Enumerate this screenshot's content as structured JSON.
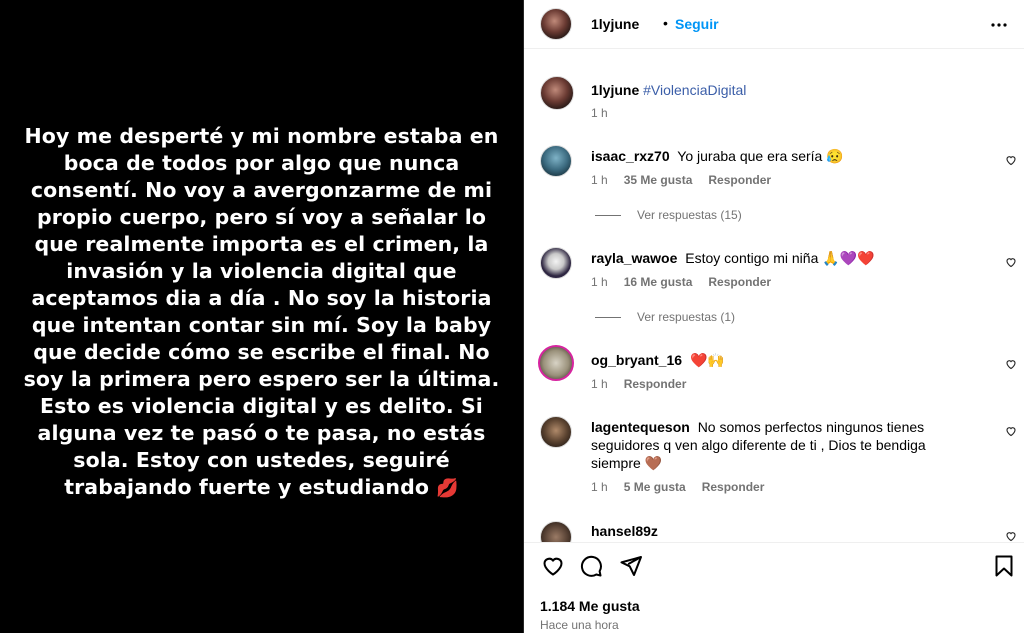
{
  "post": {
    "text": "Hoy me desperté y mi nombre estaba en boca de todos por algo que nunca consentí. No voy a avergonzarme de mi propio cuerpo, pero sí voy a señalar lo que realmente importa es el crimen, la invasión y  la violencia digital que aceptamos dia a día . No soy la historia que intentan contar sin mí. Soy la baby que decide cómo se escribe el final. No soy la primera pero espero ser la última. Esto es violencia digital y es delito. Si alguna vez te pasó o te pasa, no estás sola. Estoy con ustedes, seguiré trabajando fuerte y estudiando",
    "emoji": "💋"
  },
  "header": {
    "username": "1lyjune",
    "separator": "•",
    "follow_label": "Seguir",
    "more_icon": "more-horizontal-icon"
  },
  "caption": {
    "username": "1lyjune",
    "hashtag": "#ViolenciaDigital",
    "time": "1 h"
  },
  "comments": [
    {
      "username": "isaac_rxz70",
      "text": "Yo juraba que era sería 😥",
      "time": "1 h",
      "likes": "35 Me gusta",
      "reply_label": "Responder",
      "view_replies": "Ver respuestas (15)"
    },
    {
      "username": "rayla_wawoe",
      "text": "Estoy contigo mi niña 🙏💜❤️",
      "time": "1 h",
      "likes": "16 Me gusta",
      "reply_label": "Responder",
      "view_replies": "Ver respuestas (1)"
    },
    {
      "username": "og_bryant_16",
      "text": "❤️🙌",
      "time": "1 h",
      "reply_label": "Responder"
    },
    {
      "username": "lagentequeson",
      "text": "No somos perfectos ningunos tienes seguidores q ven algo diferente de ti , Dios te bendiga siempre 🤎",
      "time": "1 h",
      "likes": "5 Me gusta",
      "reply_label": "Responder"
    },
    {
      "username": "hansel89z",
      "text": ""
    }
  ],
  "footer": {
    "likes": "1.184 Me gusta",
    "time_ago": "Hace una hora"
  },
  "icons": [
    "heart-icon",
    "comment-icon",
    "share-icon",
    "bookmark-icon"
  ]
}
